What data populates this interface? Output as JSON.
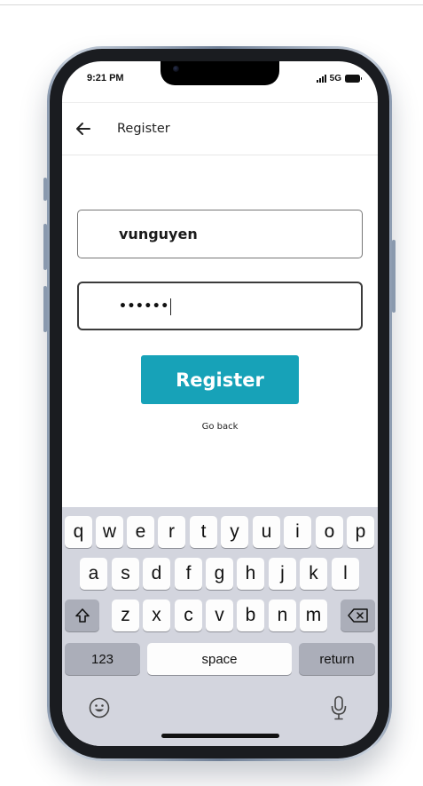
{
  "status_bar": {
    "time": "9:21 PM",
    "network": "5G"
  },
  "header": {
    "title": "Register",
    "back_icon": "arrow-left-icon"
  },
  "form": {
    "username_value": "vunguyen",
    "password_masked": "••••••"
  },
  "actions": {
    "register_label": "Register",
    "go_back_label": "Go back"
  },
  "colors": {
    "register_button": "#17a2b8",
    "keyboard_bg": "#d3d5de",
    "dark_key": "#abaeb9"
  },
  "keyboard": {
    "row1": [
      "q",
      "w",
      "e",
      "r",
      "t",
      "y",
      "u",
      "i",
      "o",
      "p"
    ],
    "row2": [
      "a",
      "s",
      "d",
      "f",
      "g",
      "h",
      "j",
      "k",
      "l"
    ],
    "row3": [
      "z",
      "x",
      "c",
      "v",
      "b",
      "n",
      "m"
    ],
    "shift_icon": "shift-icon",
    "delete_icon": "backspace-icon",
    "numbers_label": "123",
    "space_label": "space",
    "return_label": "return",
    "emoji_icon": "emoji-icon",
    "mic_icon": "microphone-icon"
  }
}
